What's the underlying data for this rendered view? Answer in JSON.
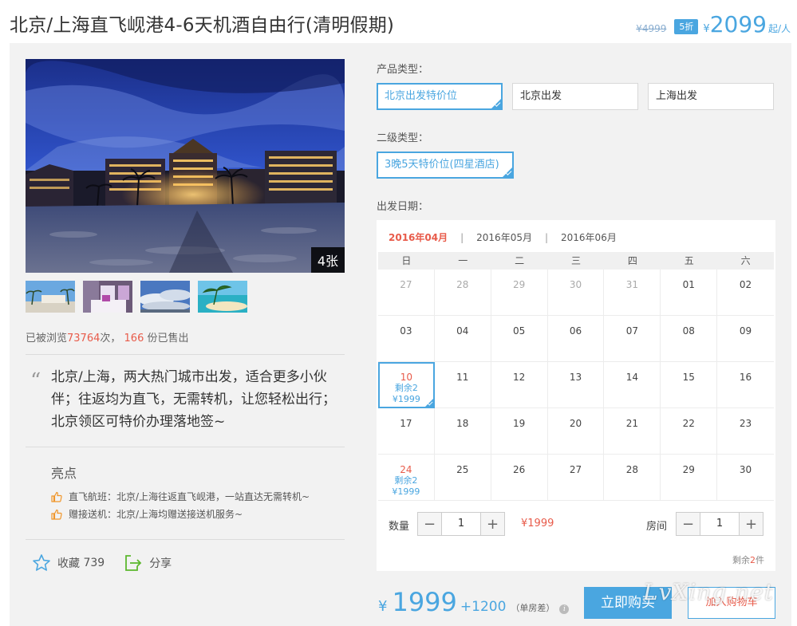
{
  "header": {
    "title": "北京/上海直飞岘港4-6天机酒自由行(清明假期)",
    "original_price": "¥4999",
    "discount": "5折",
    "currency": "¥",
    "price": "2099",
    "unit": "起/人"
  },
  "gallery": {
    "count_label": "4张",
    "thumbs": [
      "beach-palm",
      "hotel-room",
      "sky-clouds",
      "tropical-island"
    ]
  },
  "stats": {
    "prefix": "已被浏览",
    "views": "73764",
    "mid": "次，",
    "sold": "166",
    "suffix": "份已售出"
  },
  "description": "北京/上海，两大热门城市出发，适合更多小伙伴；往返均为直飞，无需转机，让您轻松出行；北京领区可特价办理落地签~",
  "highlights": {
    "title": "亮点",
    "items": [
      "直飞航班：北京/上海往返直飞岘港，一站直达无需转机~",
      "赠接送机：北京/上海均赠送接送机服务~"
    ]
  },
  "actions": {
    "favorite_label": "收藏",
    "favorite_count": "739",
    "share_label": "分享"
  },
  "product_type": {
    "label": "产品类型：",
    "options": [
      "北京出发特价位",
      "北京出发",
      "上海出发"
    ],
    "selected": 0
  },
  "sub_type": {
    "label": "二级类型：",
    "options": [
      "3晚5天特价位(四星酒店)"
    ],
    "selected": 0
  },
  "departure": {
    "label": "出发日期："
  },
  "calendar": {
    "months": [
      "2016年04月",
      "2016年05月",
      "2016年06月"
    ],
    "active_month": 0,
    "separator": "|",
    "weekdays": [
      "日",
      "一",
      "二",
      "三",
      "四",
      "五",
      "六"
    ],
    "cells": [
      {
        "d": "27",
        "other": true
      },
      {
        "d": "28",
        "other": true
      },
      {
        "d": "29",
        "other": true
      },
      {
        "d": "30",
        "other": true
      },
      {
        "d": "31",
        "other": true
      },
      {
        "d": "01"
      },
      {
        "d": "02"
      },
      {
        "d": "03"
      },
      {
        "d": "04"
      },
      {
        "d": "05"
      },
      {
        "d": "06"
      },
      {
        "d": "07"
      },
      {
        "d": "08"
      },
      {
        "d": "09"
      },
      {
        "d": "10",
        "avail": true,
        "sel": true,
        "remain": "剩余2",
        "price": "¥1999"
      },
      {
        "d": "11"
      },
      {
        "d": "12"
      },
      {
        "d": "13"
      },
      {
        "d": "14"
      },
      {
        "d": "15"
      },
      {
        "d": "16"
      },
      {
        "d": "17"
      },
      {
        "d": "18"
      },
      {
        "d": "19"
      },
      {
        "d": "20"
      },
      {
        "d": "21"
      },
      {
        "d": "22"
      },
      {
        "d": "23"
      },
      {
        "d": "24",
        "avail": true,
        "remain": "剩余2",
        "price": "¥1999"
      },
      {
        "d": "25"
      },
      {
        "d": "26"
      },
      {
        "d": "27"
      },
      {
        "d": "28"
      },
      {
        "d": "29"
      },
      {
        "d": "30"
      }
    ]
  },
  "quantity": {
    "label": "数量",
    "value": "1",
    "price": "¥1999",
    "minus": "−",
    "plus": "+"
  },
  "rooms": {
    "label": "房间",
    "value": "1",
    "minus": "−",
    "plus": "+"
  },
  "remaining": {
    "prefix": "剩余",
    "count": "2",
    "suffix": "件"
  },
  "total": {
    "currency": "¥",
    "amount": "1999",
    "extra": "+1200",
    "note": "（单房差）",
    "info": "i"
  },
  "buttons": {
    "buy": "立即购买",
    "cart": "加入购物车"
  },
  "watermark": "LvXing.net",
  "colors": {
    "accent": "#4aa6e0",
    "red": "#e85b4a",
    "panel": "#f2f2f2"
  }
}
